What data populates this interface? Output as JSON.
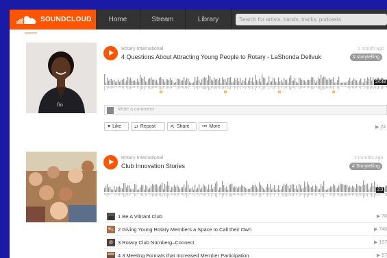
{
  "header": {
    "logo_text": "SOUNDCLOUD",
    "nav": [
      "Home",
      "Stream",
      "Library"
    ],
    "search_placeholder": "Search for artists, bands, tracks, podcasts"
  },
  "track1": {
    "user": "Rotary International",
    "title": "4 Questions About Attracting Young People to Rotary - LaShonda Dellvuk",
    "date": "1 month ago",
    "tag": "# storytelling",
    "duration": "24:48",
    "comment_placeholder": "Write a comment",
    "actions": {
      "like": "Like",
      "repost": "Repost",
      "share": "Share",
      "more": "More"
    },
    "plays": "24"
  },
  "track2": {
    "user": "Rotary International",
    "title": "Club Innovation Stories",
    "date": "2 months ago",
    "tag": "# Storytelling",
    "duration": "2:3",
    "playlist": [
      {
        "label": "1  Be A Vibrant Club",
        "plays": "76"
      },
      {
        "label": "2  Giving Young Rotary Members a Space to Call their Own",
        "plays": "748"
      },
      {
        "label": "3  Rotary Club Nürnberg–Connect",
        "plays": "107"
      },
      {
        "label": "4  3 Meeting Formats that Increased Member Participation",
        "plays": "57"
      }
    ]
  },
  "colors": {
    "brand": "#ff5500",
    "topbar": "#333333",
    "frame_background": "#1a1aa6"
  }
}
